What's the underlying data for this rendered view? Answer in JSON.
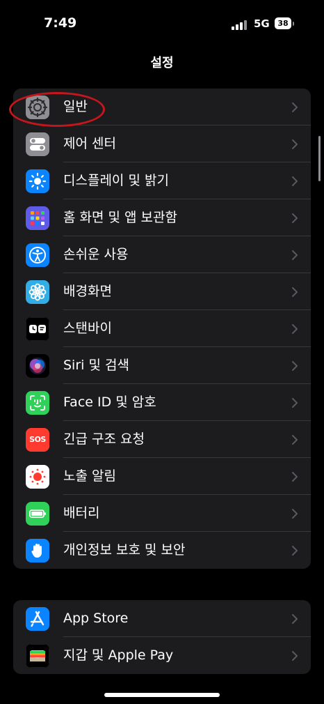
{
  "status": {
    "time": "7:49",
    "network": "5G",
    "battery": "38"
  },
  "nav": {
    "title": "설정"
  },
  "group1": [
    {
      "label": "일반",
      "icon": "gear-icon"
    },
    {
      "label": "제어 센터",
      "icon": "toggles-icon"
    },
    {
      "label": "디스플레이 및 밝기",
      "icon": "sun-icon"
    },
    {
      "label": "홈 화면 및 앱 보관함",
      "icon": "app-grid-icon"
    },
    {
      "label": "손쉬운 사용",
      "icon": "accessibility-icon"
    },
    {
      "label": "배경화면",
      "icon": "flower-icon"
    },
    {
      "label": "스탠바이",
      "icon": "standby-icon"
    },
    {
      "label": "Siri 및 검색",
      "icon": "siri-icon"
    },
    {
      "label": "Face ID 및 암호",
      "icon": "face-id-icon"
    },
    {
      "label": "긴급 구조 요청",
      "icon": "sos-icon",
      "icon_text": "SOS"
    },
    {
      "label": "노출 알림",
      "icon": "exposure-icon"
    },
    {
      "label": "배터리",
      "icon": "battery-icon"
    },
    {
      "label": "개인정보 보호 및 보안",
      "icon": "hand-icon"
    }
  ],
  "group2": [
    {
      "label": "App Store",
      "icon": "app-store-icon"
    },
    {
      "label": "지갑 및 Apple Pay",
      "icon": "wallet-icon"
    }
  ],
  "colors": {
    "background": "#000000",
    "group_background": "#1c1c1e",
    "separator": "#38383a",
    "chevron": "#5a5a5e",
    "annotation": "#c4161c"
  }
}
